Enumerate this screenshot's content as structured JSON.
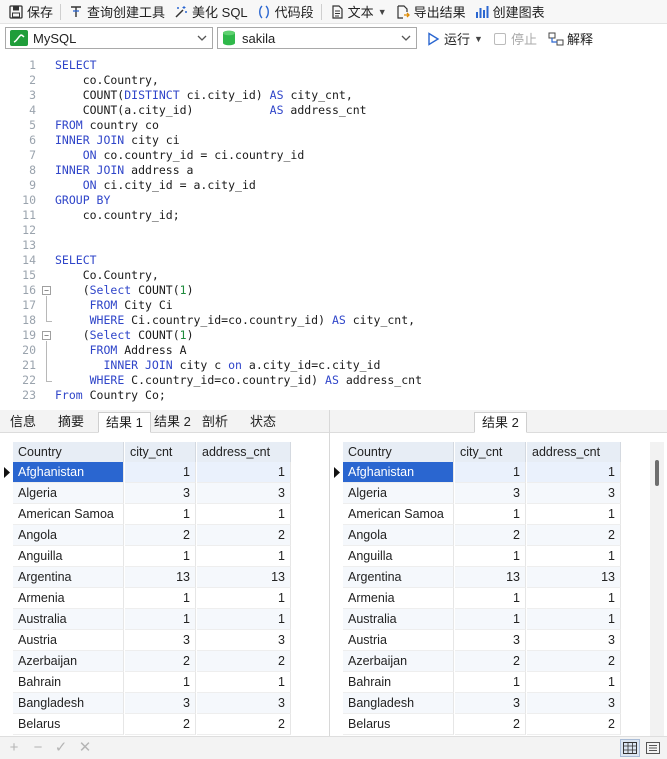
{
  "toolbar": {
    "save": "保存",
    "query_builder": "查询创建工具",
    "beautify": "美化 SQL",
    "snippet": "代码段",
    "text": "文本",
    "export": "导出结果",
    "create_chart": "创建图表"
  },
  "connection": {
    "server": "MySQL",
    "database": "sakila",
    "run": "运行",
    "stop": "停止",
    "explain": "解释"
  },
  "editor_lines": [
    {
      "n": "1",
      "html": "<span class=\"kw\">SELECT</span>"
    },
    {
      "n": "2",
      "html": "    co.Country,"
    },
    {
      "n": "3",
      "html": "    COUNT(<span class=\"kw\">DISTINCT</span> ci.city_id) <span class=\"kw\">AS</span> city_cnt,"
    },
    {
      "n": "4",
      "html": "    COUNT(a.city_id)           <span class=\"kw\">AS</span> address_cnt"
    },
    {
      "n": "5",
      "html": "<span class=\"kw\">FROM</span> country co"
    },
    {
      "n": "6",
      "html": "<span class=\"kw\">INNER JOIN</span> city ci"
    },
    {
      "n": "7",
      "html": "    <span class=\"kw\">ON</span> co.country_id = ci.country_id"
    },
    {
      "n": "8",
      "html": "<span class=\"kw\">INNER JOIN</span> address a"
    },
    {
      "n": "9",
      "html": "    <span class=\"kw\">ON</span> ci.city_id = a.city_id"
    },
    {
      "n": "10",
      "html": "<span class=\"kw\">GROUP BY</span>"
    },
    {
      "n": "11",
      "html": "    co.country_id;"
    },
    {
      "n": "12",
      "html": ""
    },
    {
      "n": "13",
      "html": ""
    },
    {
      "n": "14",
      "html": "<span class=\"kw\">SELECT</span>"
    },
    {
      "n": "15",
      "html": "    Co.Country,"
    },
    {
      "n": "16",
      "html": "    (<span class=\"kw\">Select</span> COUNT(<span class=\"num\">1</span>)"
    },
    {
      "n": "17",
      "html": "     <span class=\"kw\">FROM</span> City Ci"
    },
    {
      "n": "18",
      "html": "     <span class=\"kw\">WHERE</span> Ci.country_id=co.country_id) <span class=\"kw\">AS</span> city_cnt,"
    },
    {
      "n": "19",
      "html": "    (<span class=\"kw\">Select</span> COUNT(<span class=\"num\">1</span>)"
    },
    {
      "n": "20",
      "html": "     <span class=\"kw\">FROM</span> Address A"
    },
    {
      "n": "21",
      "html": "       <span class=\"kw\">INNER JOIN</span> city c <span class=\"kw\">on</span> a.city_id=c.city_id"
    },
    {
      "n": "22",
      "html": "     <span class=\"kw\">WHERE</span> C.country_id=co.country_id) <span class=\"kw\">AS</span> address_cnt"
    },
    {
      "n": "23",
      "html": "<span class=\"kw\">From</span> Country Co;"
    }
  ],
  "tabs_left": [
    "信息",
    "摘要",
    "结果 1",
    "结果 2",
    "剖析",
    "状态"
  ],
  "tabs_right": [
    "结果 2"
  ],
  "columns": [
    "Country",
    "city_cnt",
    "address_cnt"
  ],
  "rows": [
    [
      "Afghanistan",
      "1",
      "1"
    ],
    [
      "Algeria",
      "3",
      "3"
    ],
    [
      "American Samoa",
      "1",
      "1"
    ],
    [
      "Angola",
      "2",
      "2"
    ],
    [
      "Anguilla",
      "1",
      "1"
    ],
    [
      "Argentina",
      "13",
      "13"
    ],
    [
      "Armenia",
      "1",
      "1"
    ],
    [
      "Australia",
      "1",
      "1"
    ],
    [
      "Austria",
      "3",
      "3"
    ],
    [
      "Azerbaijan",
      "2",
      "2"
    ],
    [
      "Bahrain",
      "1",
      "1"
    ],
    [
      "Bangladesh",
      "3",
      "3"
    ],
    [
      "Belarus",
      "2",
      "2"
    ]
  ],
  "bottom": {
    "add": "+",
    "remove": "−",
    "apply": "✓",
    "discard": "✕"
  }
}
